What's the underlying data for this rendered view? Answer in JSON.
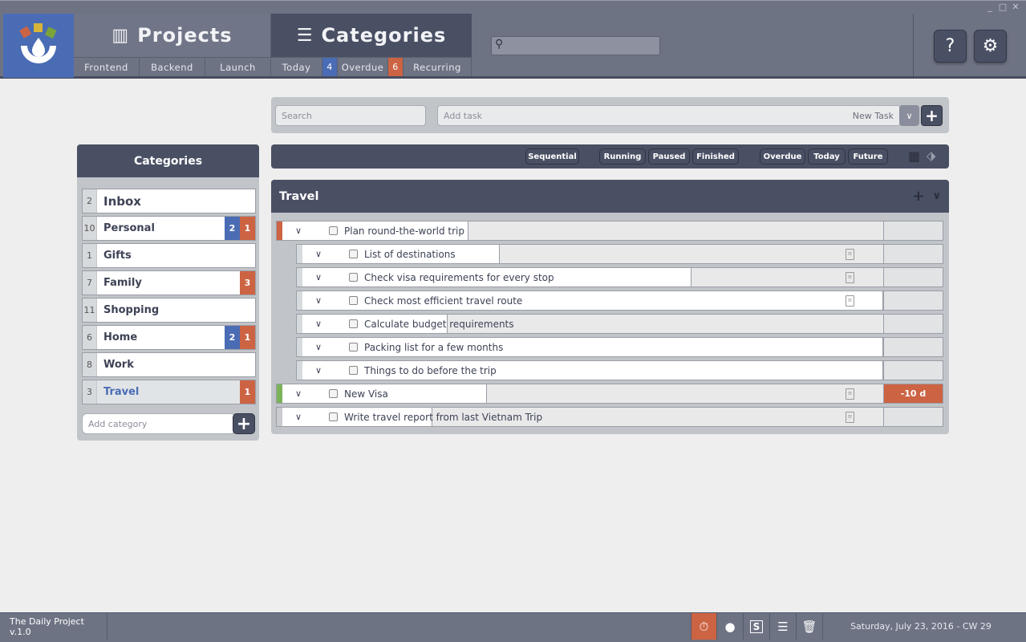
{
  "header": {
    "projects_label": "Projects",
    "categories_label": "Categories",
    "project_tabs": [
      "Frontend",
      "Backend",
      "Launch"
    ],
    "today_label": "Today",
    "today_count": "4",
    "overdue_label": "Overdue",
    "overdue_count": "6",
    "recurring_label": "Recurring",
    "help_label": "?"
  },
  "toolbar": {
    "search_placeholder": "Search",
    "add_task_placeholder": "Add task",
    "task_type": "New Task"
  },
  "filters": [
    "Sequential",
    "Running",
    "Paused",
    "Finished",
    "Overdue",
    "Today",
    "Future"
  ],
  "sidebar": {
    "title": "Categories",
    "add_placeholder": "Add category",
    "items": [
      {
        "count": "2",
        "name": "Inbox"
      },
      {
        "count": "10",
        "name": "Personal",
        "blue": "2",
        "red": "1"
      },
      {
        "count": "1",
        "name": "Gifts"
      },
      {
        "count": "7",
        "name": "Family",
        "red": "3"
      },
      {
        "count": "11",
        "name": "Shopping"
      },
      {
        "count": "6",
        "name": "Home",
        "blue": "2",
        "red": "1"
      },
      {
        "count": "8",
        "name": "Work"
      },
      {
        "count": "3",
        "name": "Travel",
        "red": "1"
      }
    ]
  },
  "list": {
    "title": "Travel",
    "tasks": [
      {
        "title": "Plan round-the-world trip",
        "progress": 0.31,
        "level": 0,
        "stripe": "#cc6444"
      },
      {
        "title": "List of destinations",
        "progress": 0.34,
        "level": 1,
        "note": true
      },
      {
        "title": "Check visa requirements for every stop",
        "progress": 0.67,
        "level": 1,
        "note": true
      },
      {
        "title": "Check most efficient travel route",
        "progress": 1.0,
        "level": 1,
        "note": true
      },
      {
        "title": "Calculate budget requirements",
        "progress": 0.25,
        "level": 1
      },
      {
        "title": "Packing list for a few months",
        "progress": 1.0,
        "level": 1
      },
      {
        "title": "Things to do before the trip",
        "progress": 1.0,
        "level": 1
      },
      {
        "title": "New Visa",
        "progress": 0.34,
        "level": 0,
        "stripe": "#7bb35a",
        "note": true,
        "due": "-10 d"
      },
      {
        "title": "Write travel report from last Vietnam Trip",
        "progress": 0.25,
        "level": 0,
        "stripe": "#c9cbce",
        "note": true
      }
    ]
  },
  "footer": {
    "app_version": "The Daily Project v.1.0",
    "date": "Saturday, July 23, 2016 - CW 29"
  },
  "colors": {
    "accent_blue": "#4a6cb4",
    "accent_red": "#cc6444",
    "dark": "#4a5064"
  }
}
